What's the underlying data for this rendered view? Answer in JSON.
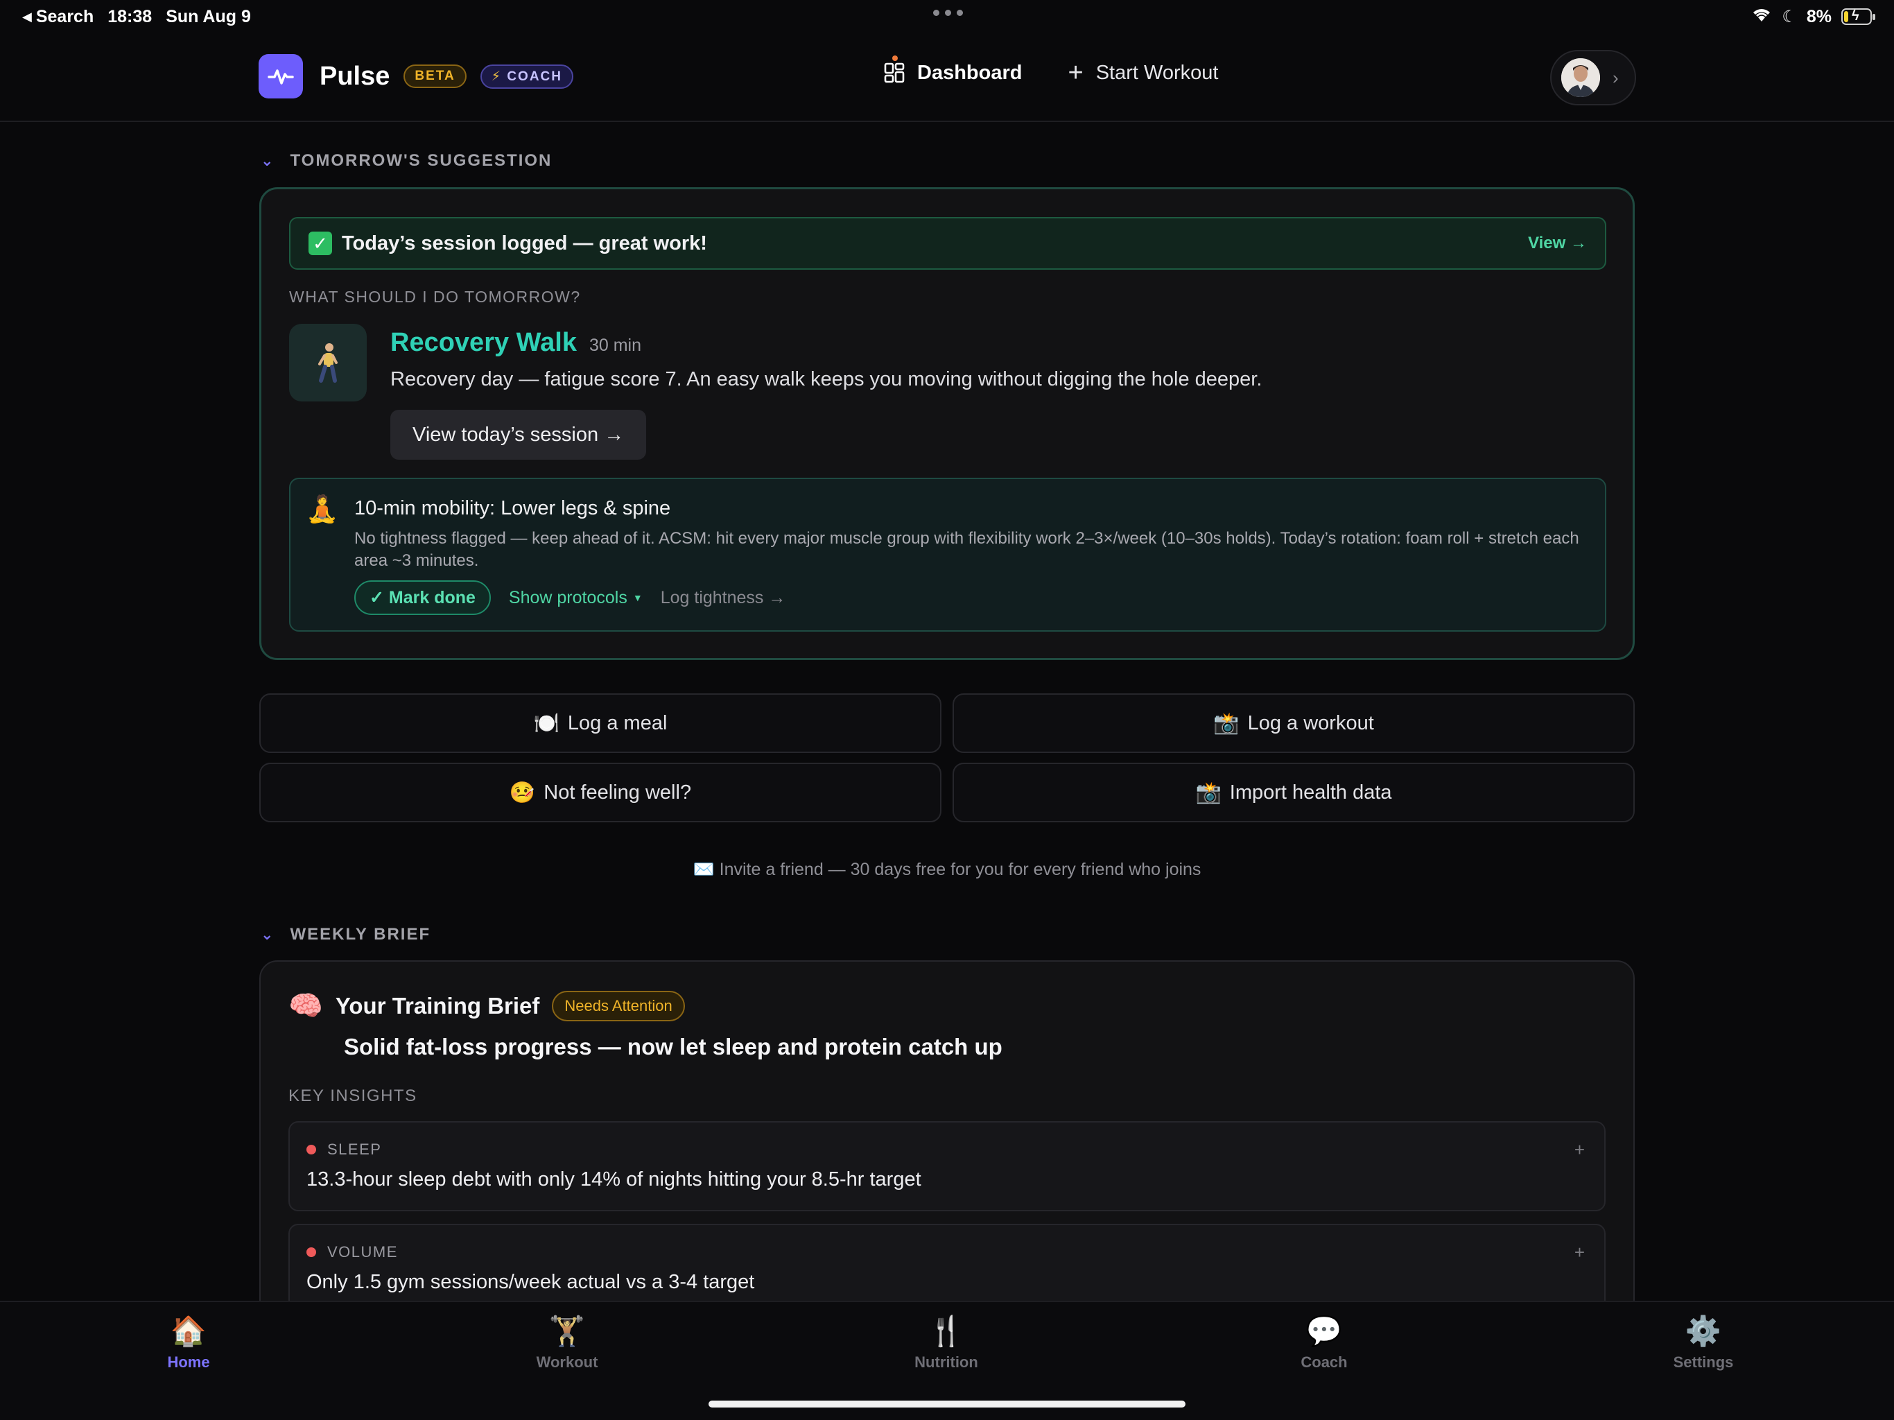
{
  "status_bar": {
    "back_label": "Search",
    "time": "18:38",
    "date": "Sun Aug 9",
    "battery": "8%"
  },
  "header": {
    "app_name": "Pulse",
    "beta_badge": "BETA",
    "coach_badge": "COACH",
    "nav": {
      "dashboard": "Dashboard",
      "start_workout": "Start Workout"
    }
  },
  "suggestion": {
    "section_title": "TOMORROW'S SUGGESTION",
    "logged_message": "Today’s session logged — great work!",
    "view_link": "View →",
    "question": "WHAT SHOULD I DO TOMORROW?",
    "workout_name": "Recovery Walk",
    "duration": "30 min",
    "description": "Recovery day — fatigue score 7. An easy walk keeps you moving without digging the hole deeper.",
    "view_session_button": "View today’s session →",
    "mobility": {
      "title": "10-min mobility: Lower legs & spine",
      "body": "No tightness flagged — keep ahead of it. ACSM: hit every major muscle group with flexibility work 2–3×/week (10–30s holds). Today’s rotation: foam roll + stretch each area ~3 minutes.",
      "mark_done": "✓ Mark done",
      "show_protocols": "Show protocols",
      "log_tightness": "Log tightness →"
    }
  },
  "actions": {
    "log_meal": "Log a meal",
    "log_workout": "Log a workout",
    "not_feeling_well": "Not feeling well?",
    "import_health": "Import health data"
  },
  "invite_text": "Invite a friend — 30 days free for you for every friend who joins",
  "brief": {
    "section_title": "WEEKLY BRIEF",
    "title": "Your Training Brief",
    "status_badge": "Needs Attention",
    "headline": "Solid fat-loss progress — now let sleep and protein catch up",
    "insights_label": "KEY INSIGHTS",
    "insights": [
      {
        "category": "SLEEP",
        "text": "13.3-hour sleep debt with only 14% of nights hitting your 8.5-hr target"
      },
      {
        "category": "VOLUME",
        "text": "Only 1.5 gym sessions/week actual vs a 3-4 target"
      }
    ]
  },
  "tabbar": {
    "items": [
      {
        "label": "Home",
        "icon": "home-icon"
      },
      {
        "label": "Workout",
        "icon": "weightlifter-icon"
      },
      {
        "label": "Nutrition",
        "icon": "fork-knife-icon"
      },
      {
        "label": "Coach",
        "icon": "chat-bubble-icon"
      },
      {
        "label": "Settings",
        "icon": "gear-icon"
      }
    ]
  },
  "colors": {
    "accent": "#6d5dfc",
    "teal": "#2fd1b6",
    "green": "#4fd6a4",
    "warning": "#f0b429",
    "alert_dot": "#ef5a5a",
    "background": "#09090b"
  }
}
